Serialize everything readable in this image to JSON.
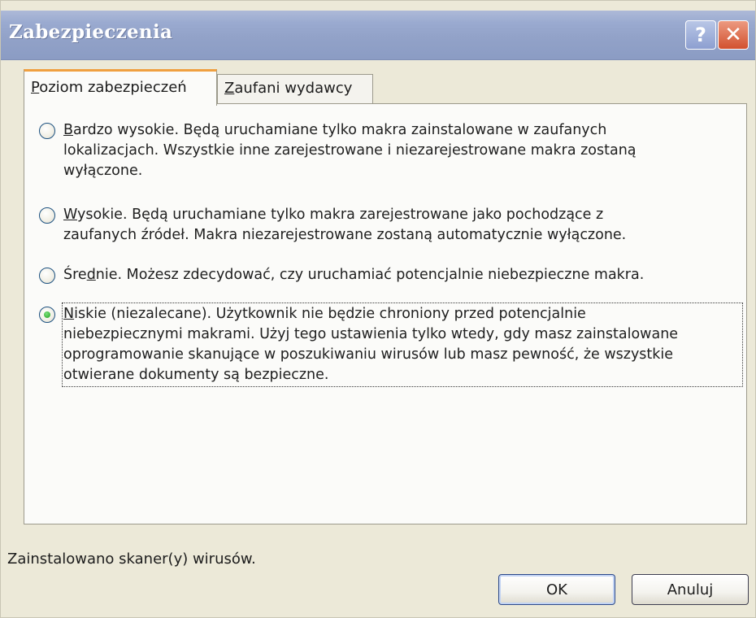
{
  "window": {
    "title": "Zabezpieczenia",
    "help_glyph": "?",
    "close_glyph": "✕"
  },
  "tabs": [
    {
      "pre": "",
      "mnemonic": "P",
      "post": "oziom zabezpieczeń",
      "active": true
    },
    {
      "pre": "",
      "mnemonic": "Z",
      "post": "aufani wydawcy",
      "active": false
    }
  ],
  "options": [
    {
      "mnemonic": "B",
      "line1_rest": "ardzo wysokie. Będą uruchamiane tylko makra zainstalowane w zaufanych",
      "line2": "lokalizacjach. Wszystkie inne zarejestrowane i niezarejestrowane makra zostaną",
      "line3": "wyłączone.",
      "selected": false
    },
    {
      "mnemonic": "W",
      "line1_rest": "ysokie. Będą uruchamiane tylko makra zarejestrowane jako pochodzące z",
      "line2": "zaufanych źródeł. Makra niezarejestrowane zostaną automatycznie wyłączone.",
      "selected": false
    },
    {
      "pre": "Śre",
      "mnemonic": "d",
      "line1_rest": "nie. Możesz zdecydować, czy uruchamiać potencjalnie niebezpieczne makra.",
      "selected": false
    },
    {
      "mnemonic": "N",
      "line1_rest": "iskie (niezalecane). Użytkownik nie będzie chroniony przed potencjalnie",
      "line2": "niebezpiecznymi makrami. Użyj tego ustawienia tylko wtedy, gdy masz zainstalowane",
      "line3": "oprogramowanie skanujące w poszukiwaniu wirusów lub masz pewność, że wszystkie",
      "line4": "otwierane dokumenty są bezpieczne.",
      "selected": true
    }
  ],
  "status": "Zainstalowano skaner(y) wirusów.",
  "buttons": {
    "ok": "OK",
    "cancel": "Anuluj"
  }
}
